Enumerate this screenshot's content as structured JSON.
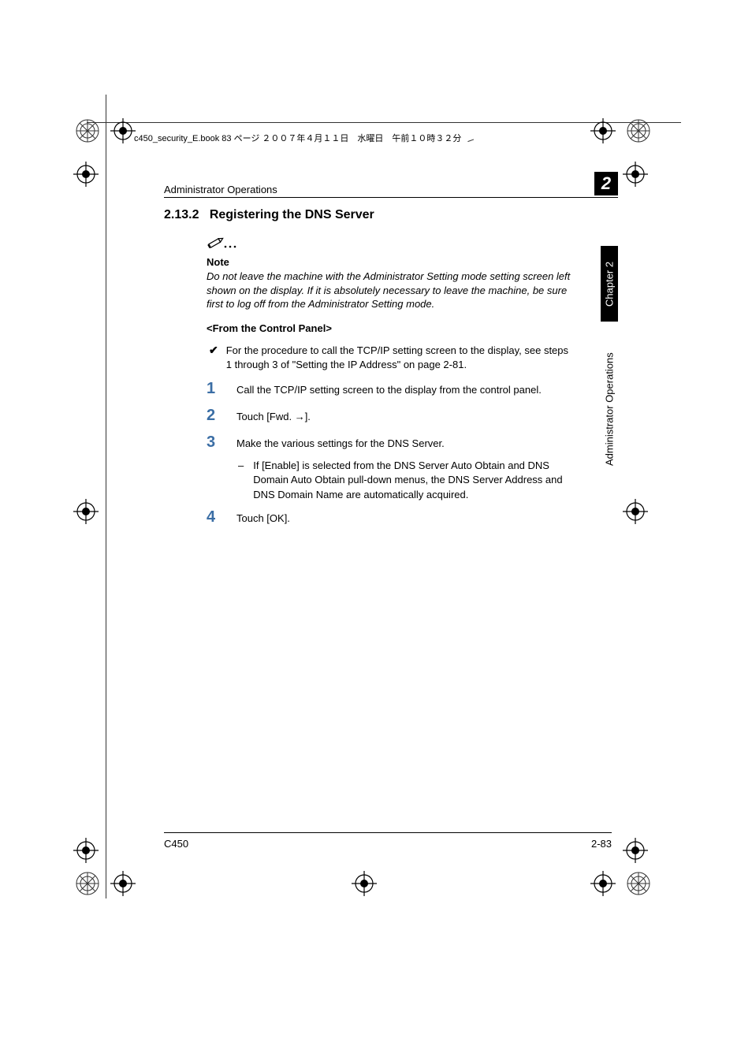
{
  "header_line": "c450_security_E.book  83 ページ  ２００７年４月１１日　水曜日　午前１０時３２分",
  "section_header": "Administrator Operations",
  "chapter_num": "2",
  "section_number": "2.13.2",
  "section_title": "Registering the DNS Server",
  "note": {
    "label": "Note",
    "body": "Do not leave the machine with the Administrator Setting mode setting screen left shown on the display. If it is absolutely necessary to leave the machine, be sure first to log off from the Administrator Setting mode."
  },
  "subheading": "<From the Control Panel>",
  "check_item": "For the procedure to call the TCP/IP setting screen to the display, see steps 1 through 3 of \"Setting the IP Address\" on page 2-81.",
  "steps": {
    "s1": "Call the TCP/IP setting screen to the display from the control panel.",
    "s2": "Touch [Fwd. →].",
    "s3_main": "Make the various settings for the DNS Server.",
    "s3_sub": "If [Enable] is selected from the DNS Server Auto Obtain and DNS Domain Auto Obtain pull-down menus, the DNS Server Address and DNS Domain Name are automatically acquired.",
    "s4": "Touch [OK]."
  },
  "side_tab_chapter": "Chapter 2",
  "side_tab_ops": "Administrator Operations",
  "footer_left": "C450",
  "footer_right": "2-83"
}
